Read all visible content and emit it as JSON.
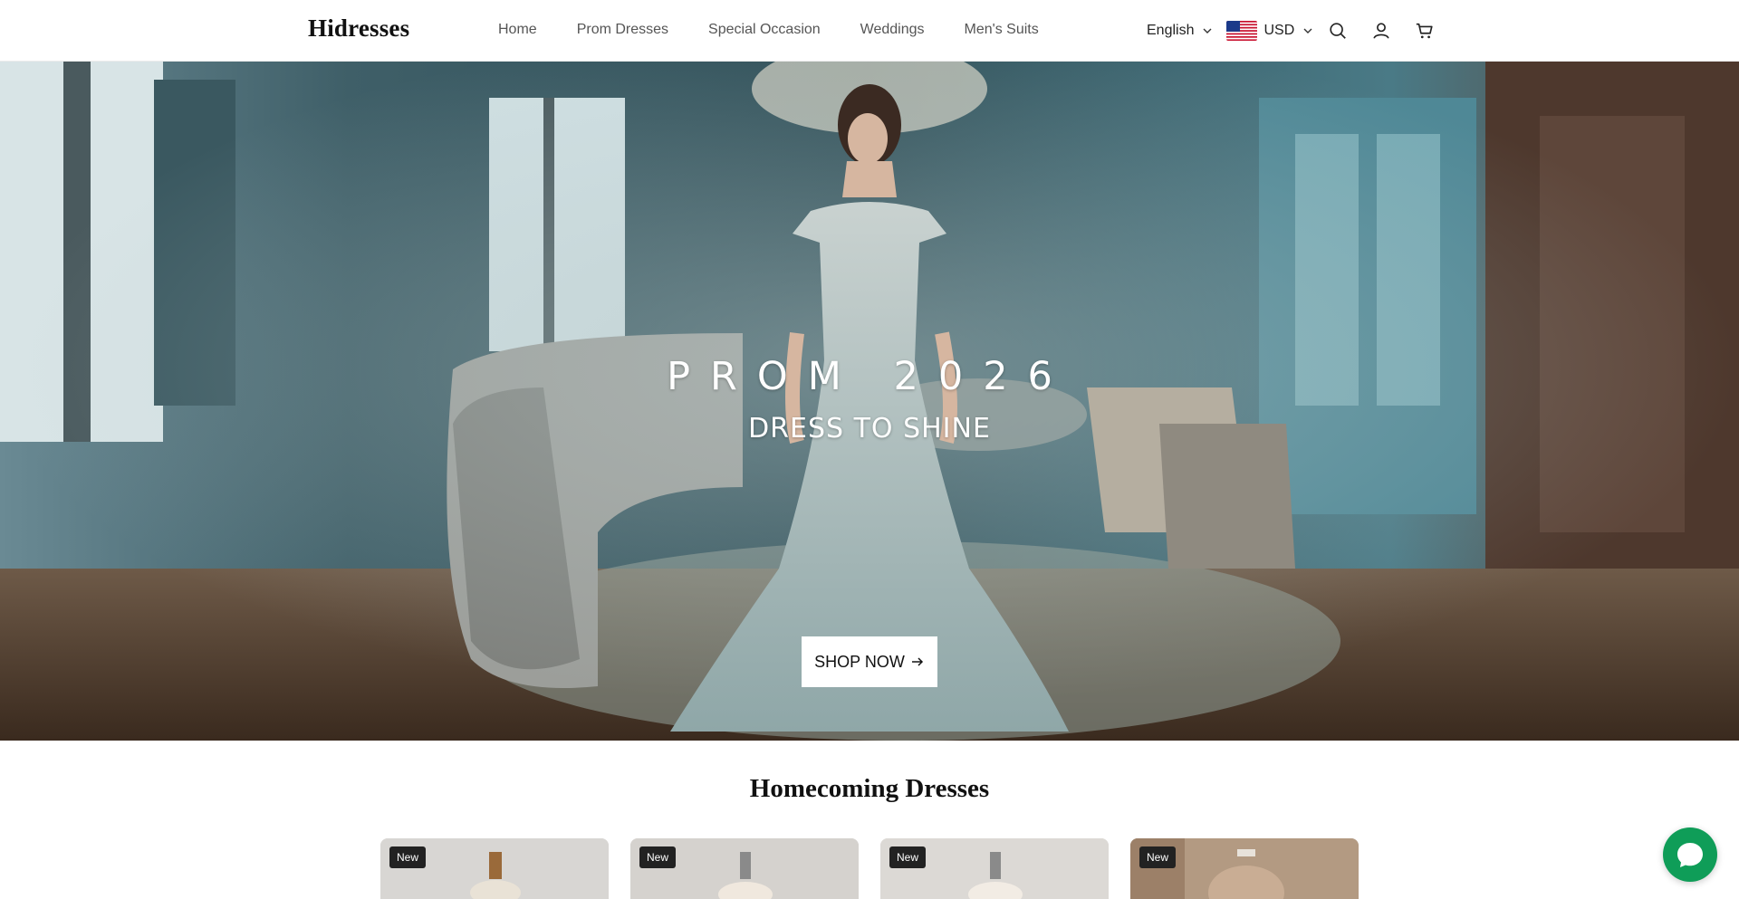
{
  "header": {
    "logo": "Hidresses",
    "nav": [
      {
        "label": "Home"
      },
      {
        "label": "Prom Dresses"
      },
      {
        "label": "Special Occasion"
      },
      {
        "label": "Weddings"
      },
      {
        "label": "Men's Suits"
      }
    ],
    "language": "English",
    "currency": "USD",
    "icons": [
      "chevron-down-icon",
      "us-flag-icon",
      "search-icon",
      "account-icon",
      "cart-icon"
    ]
  },
  "hero": {
    "title": "PROM 2026",
    "subtitle": "DRESS TO SHINE",
    "cta_label": "SHOP NOW",
    "cta_icon": "arrow-right-icon"
  },
  "section": {
    "title": "Homecoming Dresses",
    "cards": [
      {
        "badge": "New"
      },
      {
        "badge": "New"
      },
      {
        "badge": "New"
      },
      {
        "badge": "New"
      }
    ]
  },
  "chat": {
    "icon": "chat-icon",
    "color": "#0f9d58"
  }
}
